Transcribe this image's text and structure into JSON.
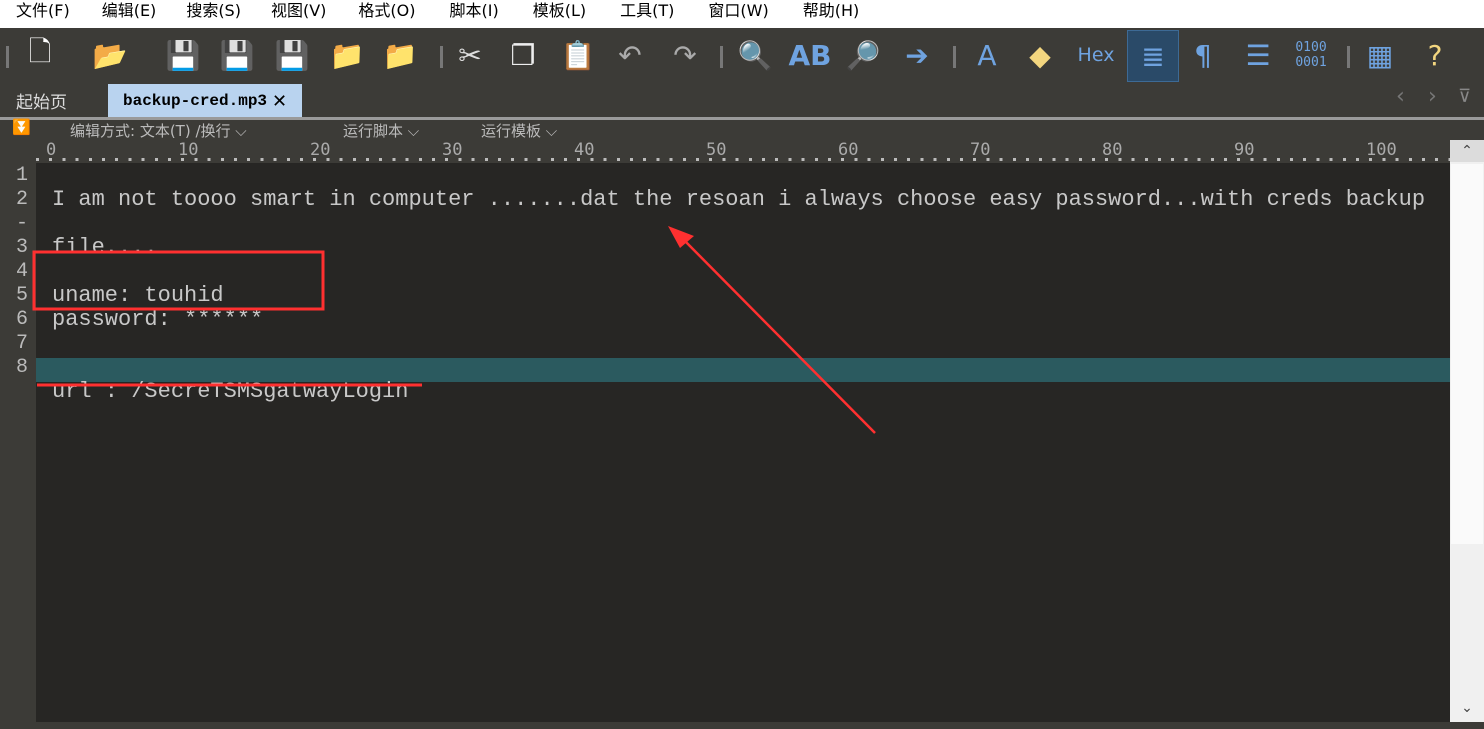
{
  "menu": [
    "文件(F)",
    "编辑(E)",
    "搜索(S)",
    "视图(V)",
    "格式(O)",
    "脚本(I)",
    "模板(L)",
    "工具(T)",
    "窗口(W)",
    "帮助(H)"
  ],
  "toolbar": {
    "hex_label": "Hex",
    "icons": [
      "new-file-icon",
      "open-folder-icon",
      "save-icon",
      "save-as-icon",
      "save-all-icon",
      "folder-icon",
      "folders-icon",
      "cut-icon",
      "copy-icon",
      "paste-icon",
      "undo-icon",
      "redo-icon",
      "find-icon",
      "replace-icon",
      "find-in-files-icon",
      "goto-icon",
      "font-icon",
      "highlight-icon",
      "hex-icon",
      "word-wrap-icon",
      "pilcrow-icon",
      "columns-icon",
      "binary-icon",
      "calculator-icon",
      "help-icon"
    ]
  },
  "tabs": {
    "start": "起始页",
    "active": "backup-cred.mp3",
    "close": "✕"
  },
  "subbar": {
    "edit_mode": "编辑方式: 文本(T) /换行",
    "run_script": "运行脚本",
    "run_template": "运行模板"
  },
  "ruler": [
    "0",
    "10",
    "20",
    "30",
    "40",
    "50",
    "60",
    "70",
    "80",
    "90",
    "100"
  ],
  "gutter": [
    "1",
    "2",
    "-",
    "3",
    "4",
    "5",
    "6",
    "7",
    "8"
  ],
  "lines": [
    "",
    "I am not toooo smart in computer .......dat the resoan i always choose easy password...with creds backup",
    "file....",
    "",
    "uname: touhid",
    "password: ******",
    "",
    "",
    "url : /SecreTSMSgatwayLogin"
  ],
  "colors": {
    "annotation": "#ff3030",
    "highlight": "#2b5a5f",
    "tab_active": "#b9d3ef"
  }
}
